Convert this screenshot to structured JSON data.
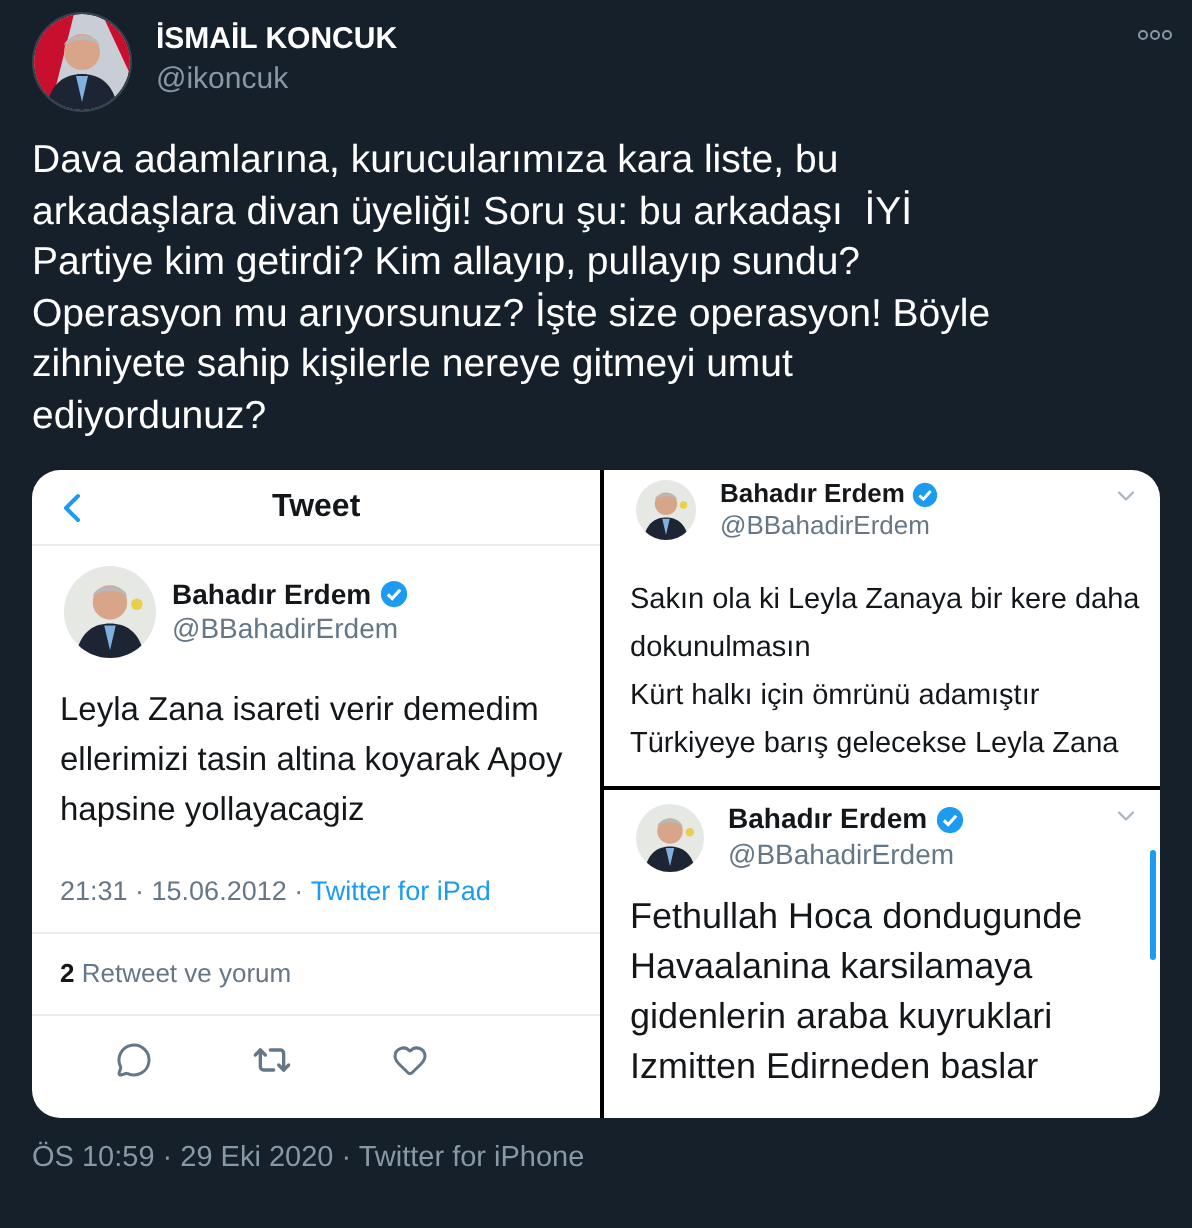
{
  "author": {
    "name": "İSMAİL KONCUK",
    "handle": "@ikoncuk"
  },
  "text": "Dava adamlarına, kurucularımıza kara liste, bu arkadaşlara divan üyeliği! Soru şu: bu arkadaşı  İYİ Partiye kim getirdi? Kim allayıp, pullayıp sundu? Operasyon mu arıyorsunuz? İşte size operasyon! Böyle zihniyete sahip kişilerle nereye gitmeyi umut ediyordunuz?",
  "media": [
    {
      "kind": "tweet_page",
      "title": "Tweet",
      "author": {
        "name": "Bahadır Erdem",
        "handle": "@BBahadirErdem",
        "verified": true
      },
      "lines": [
        "Leyla Zana isareti verir demedim",
        "ellerimizi tasin altina koyarak Apoy",
        "hapsine yollayacagiz"
      ],
      "time": "21:31 · 15.06.2012 · ",
      "source": "Twitter for iPad",
      "stats": "**2** Retweet ve yorum"
    },
    {
      "kind": "tweet_card",
      "author": {
        "name": "Bahadır Erdem",
        "handle": "@BBahadirErdem",
        "verified": true
      },
      "lines": [
        "Sakın ola ki Leyla Zanaya bir kere daha",
        "dokunulmasın",
        "Kürt halkı için ömrünü adamıştır",
        "Türkiyeye barış gelecekse Leyla Zana"
      ]
    },
    {
      "kind": "tweet_card_large",
      "author": {
        "name": "Bahadır Erdem",
        "handle": "@BBahadirErdem",
        "verified": true
      },
      "lines": [
        "Fethullah Hoca dondugunde",
        "Havaalanina karsilamaya",
        "gidenlerin araba kuyruklari",
        "Izmitten Edirneden baslar"
      ]
    }
  ],
  "footer": "ÖS 10:59 · 29 Eki 2020 · Twitter for iPhone"
}
